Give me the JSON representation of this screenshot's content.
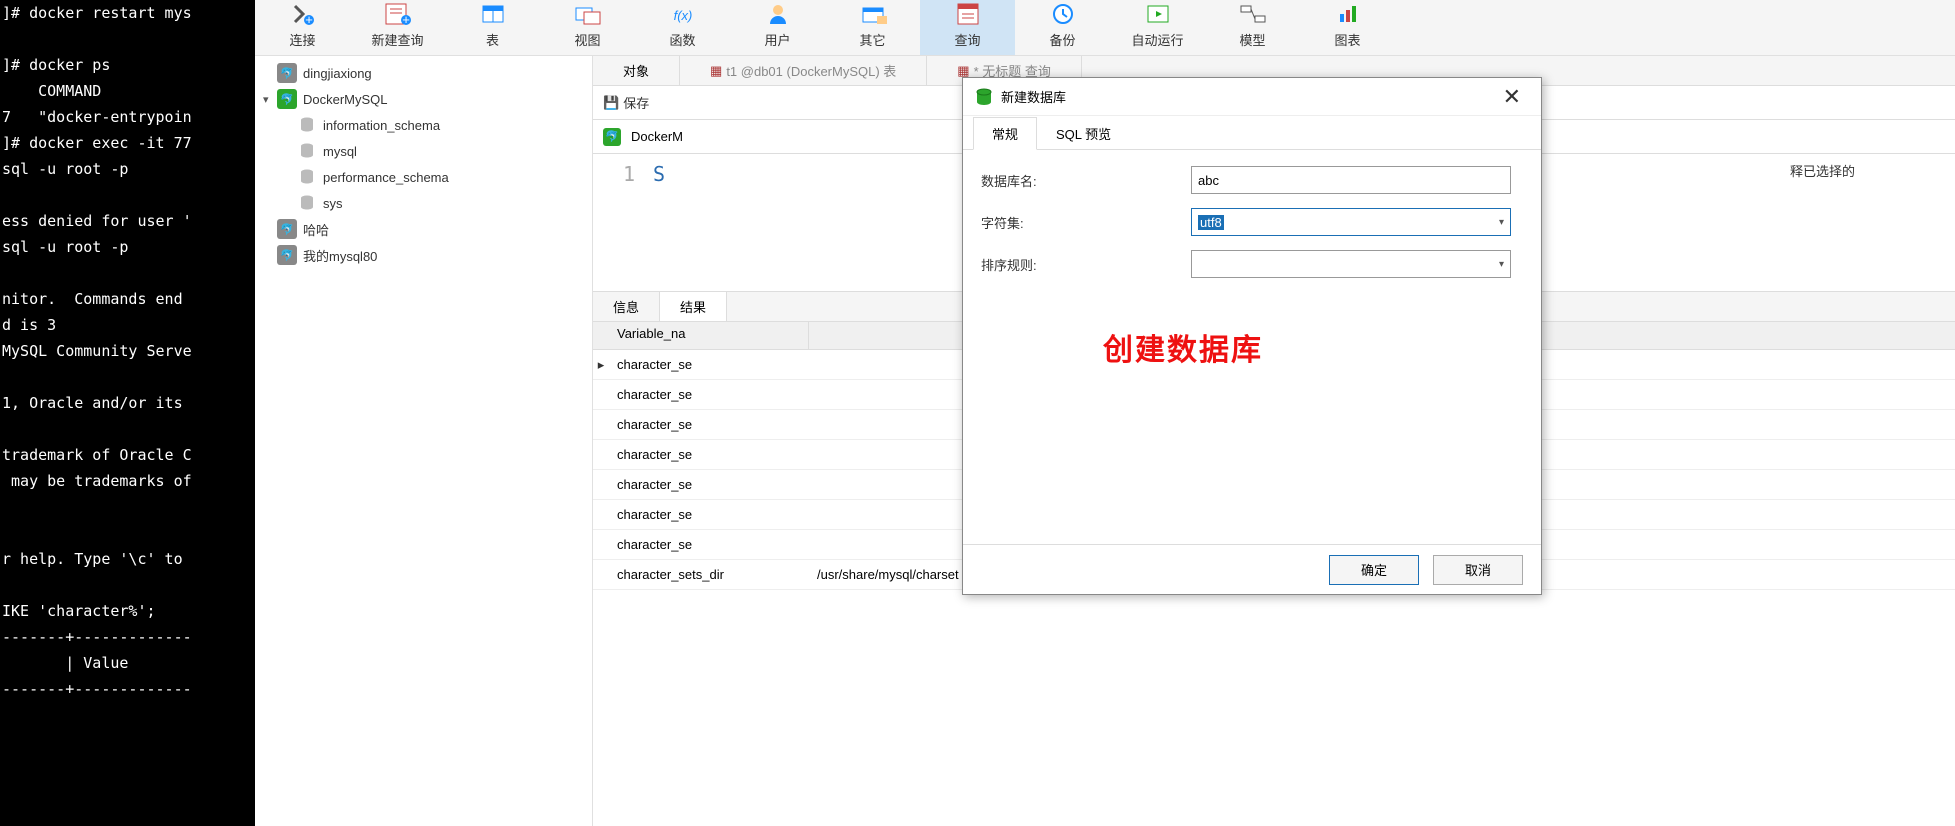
{
  "terminal_lines": [
    "]# docker restart mys",
    "",
    "]# docker ps",
    "    COMMAND",
    "7   \"docker-entrypoin",
    "]# docker exec -it 77",
    "sql -u root -p",
    "",
    "ess denied for user '",
    "sql -u root -p",
    "",
    "nitor.  Commands end ",
    "d is 3",
    "MySQL Community Serve",
    "",
    "1, Oracle and/or its ",
    "",
    "trademark of Oracle C",
    " may be trademarks of",
    "",
    "",
    "r help. Type '\\c' to ",
    "",
    "IKE 'character%';",
    "-------+-------------",
    "       | Value",
    "-------+-------------"
  ],
  "toolbar": [
    {
      "key": "connect",
      "label": "连接"
    },
    {
      "key": "new-query",
      "label": "新建查询"
    },
    {
      "key": "table",
      "label": "表"
    },
    {
      "key": "view",
      "label": "视图"
    },
    {
      "key": "function",
      "label": "函数"
    },
    {
      "key": "user",
      "label": "用户"
    },
    {
      "key": "other",
      "label": "其它"
    },
    {
      "key": "query",
      "label": "查询",
      "active": true
    },
    {
      "key": "backup",
      "label": "备份"
    },
    {
      "key": "auto-run",
      "label": "自动运行"
    },
    {
      "key": "model",
      "label": "模型"
    },
    {
      "key": "chart",
      "label": "图表"
    }
  ],
  "tree": [
    {
      "label": "dingjiaxiong",
      "type": "conn-grey"
    },
    {
      "label": "DockerMySQL",
      "type": "conn-green",
      "expanded": true,
      "children": [
        {
          "label": "information_schema",
          "type": "db"
        },
        {
          "label": "mysql",
          "type": "db"
        },
        {
          "label": "performance_schema",
          "type": "db"
        },
        {
          "label": "sys",
          "type": "db"
        }
      ]
    },
    {
      "label": "哈哈",
      "type": "conn-grey"
    },
    {
      "label": "我的mysql80",
      "type": "conn-grey"
    }
  ],
  "content_tabs": {
    "object": "对象",
    "t1": "t1 @db01 (DockerMySQL)  表",
    "untitled": "* 无标题  查询"
  },
  "sub_toolbar": {
    "save": "保存"
  },
  "path": {
    "conn": "DockerM",
    "advice": "释已选择的"
  },
  "editor": {
    "line1_num": "1",
    "line1_code": "S"
  },
  "lower_tabs": {
    "info": "信息",
    "result": "结果"
  },
  "result_header": {
    "col1": "Variable_na"
  },
  "result_rows": [
    {
      "name": "character_se",
      "val": "",
      "ptr": true
    },
    {
      "name": "character_se",
      "val": ""
    },
    {
      "name": "character_se",
      "val": ""
    },
    {
      "name": "character_se",
      "val": ""
    },
    {
      "name": "character_se",
      "val": ""
    },
    {
      "name": "character_se",
      "val": ""
    },
    {
      "name": "character_se",
      "val": ""
    },
    {
      "name": "character_sets_dir",
      "val": "/usr/share/mysql/charset"
    }
  ],
  "dialog": {
    "title": "新建数据库",
    "tabs": {
      "general": "常规",
      "sql_preview": "SQL 预览"
    },
    "form": {
      "db_name_label": "数据库名:",
      "db_name_value": "abc",
      "charset_label": "字符集:",
      "charset_value": "utf8",
      "collation_label": "排序规则:",
      "collation_value": ""
    },
    "annotation": "创建数据库",
    "ok": "确定",
    "cancel": "取消"
  }
}
